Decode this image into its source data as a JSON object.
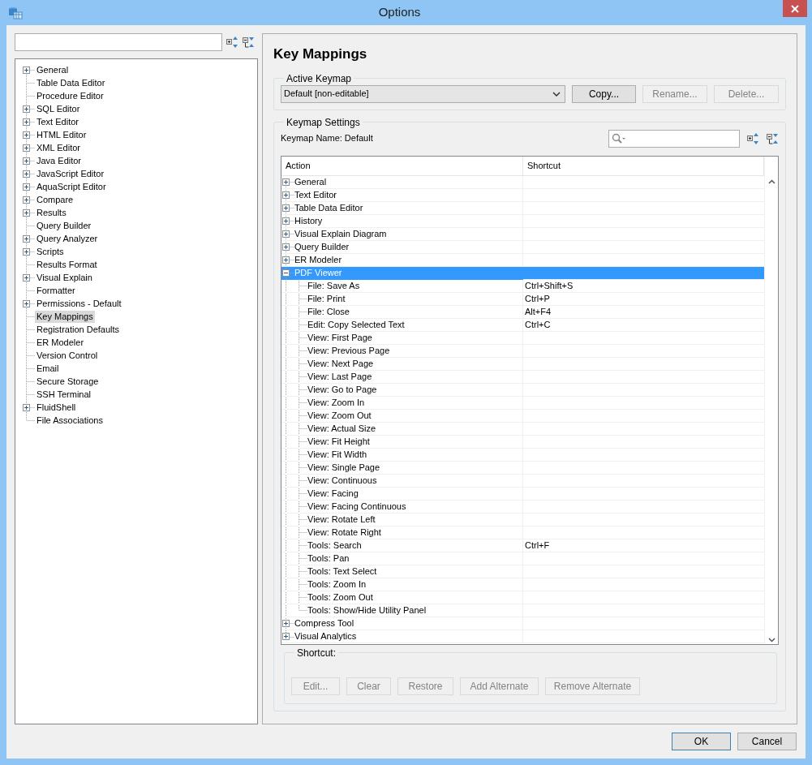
{
  "window": {
    "title": "Options"
  },
  "nav_tree": [
    {
      "label": "General",
      "kind": "group",
      "selected": false
    },
    {
      "label": "Table Data Editor",
      "kind": "leaf",
      "selected": false
    },
    {
      "label": "Procedure Editor",
      "kind": "leaf",
      "selected": false
    },
    {
      "label": "SQL Editor",
      "kind": "group",
      "selected": false
    },
    {
      "label": "Text Editor",
      "kind": "group",
      "selected": false
    },
    {
      "label": "HTML Editor",
      "kind": "group",
      "selected": false
    },
    {
      "label": "XML Editor",
      "kind": "group",
      "selected": false
    },
    {
      "label": "Java Editor",
      "kind": "group",
      "selected": false
    },
    {
      "label": "JavaScript Editor",
      "kind": "group",
      "selected": false
    },
    {
      "label": "AquaScript Editor",
      "kind": "group",
      "selected": false
    },
    {
      "label": "Compare",
      "kind": "group",
      "selected": false
    },
    {
      "label": "Results",
      "kind": "group",
      "selected": false
    },
    {
      "label": "Query Builder",
      "kind": "leaf",
      "selected": false
    },
    {
      "label": "Query Analyzer",
      "kind": "group",
      "selected": false
    },
    {
      "label": "Scripts",
      "kind": "group",
      "selected": false
    },
    {
      "label": "Results Format",
      "kind": "leaf",
      "selected": false
    },
    {
      "label": "Visual Explain",
      "kind": "group",
      "selected": false
    },
    {
      "label": "Formatter",
      "kind": "leaf",
      "selected": false
    },
    {
      "label": "Permissions - Default",
      "kind": "group",
      "selected": false
    },
    {
      "label": "Key Mappings",
      "kind": "leaf",
      "selected": true
    },
    {
      "label": "Registration Defaults",
      "kind": "leaf",
      "selected": false
    },
    {
      "label": "ER Modeler",
      "kind": "leaf",
      "selected": false
    },
    {
      "label": "Version Control",
      "kind": "leaf",
      "selected": false
    },
    {
      "label": "Email",
      "kind": "leaf",
      "selected": false
    },
    {
      "label": "Secure Storage",
      "kind": "leaf",
      "selected": false
    },
    {
      "label": "SSH Terminal",
      "kind": "leaf",
      "selected": false
    },
    {
      "label": "FluidShell",
      "kind": "group",
      "selected": false
    },
    {
      "label": "File Associations",
      "kind": "leaf",
      "selected": false
    }
  ],
  "page_title": "Key Mappings",
  "active_keymap": {
    "legend": "Active Keymap",
    "value": "Default [non-editable]",
    "buttons": [
      {
        "label": "Copy...",
        "disabled": false
      },
      {
        "label": "Rename...",
        "disabled": true
      },
      {
        "label": "Delete...",
        "disabled": true
      }
    ]
  },
  "keymap_settings": {
    "legend": "Keymap Settings",
    "name_label": "Keymap Name: Default",
    "columns": [
      "Action",
      "Shortcut"
    ],
    "rows": [
      {
        "action": "General",
        "expanded": false,
        "selected": false
      },
      {
        "action": "Text Editor",
        "expanded": false,
        "selected": false
      },
      {
        "action": "Table Data Editor",
        "expanded": false,
        "selected": false
      },
      {
        "action": "History",
        "expanded": false,
        "selected": false
      },
      {
        "action": "Visual Explain Diagram",
        "expanded": false,
        "selected": false
      },
      {
        "action": "Query Builder",
        "expanded": false,
        "selected": false
      },
      {
        "action": "ER Modeler",
        "expanded": false,
        "selected": false
      },
      {
        "action": "PDF Viewer",
        "expanded": true,
        "selected": true,
        "children": [
          {
            "action": "File: Save As",
            "shortcut": "Ctrl+Shift+S"
          },
          {
            "action": "File: Print",
            "shortcut": "Ctrl+P"
          },
          {
            "action": "File: Close",
            "shortcut": "Alt+F4"
          },
          {
            "action": "Edit: Copy Selected Text",
            "shortcut": "Ctrl+C"
          },
          {
            "action": "View: First Page"
          },
          {
            "action": "View: Previous Page"
          },
          {
            "action": "View: Next Page"
          },
          {
            "action": "View: Last Page"
          },
          {
            "action": "View: Go to Page"
          },
          {
            "action": "View: Zoom In"
          },
          {
            "action": "View: Zoom Out"
          },
          {
            "action": "View: Actual Size"
          },
          {
            "action": "View: Fit Height"
          },
          {
            "action": "View: Fit Width"
          },
          {
            "action": "View: Single Page"
          },
          {
            "action": "View: Continuous"
          },
          {
            "action": "View: Facing"
          },
          {
            "action": "View: Facing Continuous"
          },
          {
            "action": "View: Rotate Left"
          },
          {
            "action": "View: Rotate Right"
          },
          {
            "action": "Tools: Search",
            "shortcut": "Ctrl+F"
          },
          {
            "action": "Tools: Pan"
          },
          {
            "action": "Tools: Text Select"
          },
          {
            "action": "Tools: Zoom In"
          },
          {
            "action": "Tools: Zoom Out"
          },
          {
            "action": "Tools: Show/Hide Utility Panel"
          }
        ]
      },
      {
        "action": "Compress Tool",
        "expanded": false,
        "selected": false
      },
      {
        "action": "Visual Analytics",
        "expanded": false,
        "selected": false
      }
    ]
  },
  "shortcut": {
    "legend": "Shortcut:",
    "buttons": [
      {
        "label": "Edit...",
        "disabled": true
      },
      {
        "label": "Clear",
        "disabled": true
      },
      {
        "label": "Restore",
        "disabled": true
      },
      {
        "label": "Add Alternate",
        "disabled": true
      },
      {
        "label": "Remove Alternate",
        "disabled": true
      }
    ]
  },
  "footer_buttons": [
    {
      "label": "OK",
      "default": true
    },
    {
      "label": "Cancel",
      "default": false
    }
  ]
}
